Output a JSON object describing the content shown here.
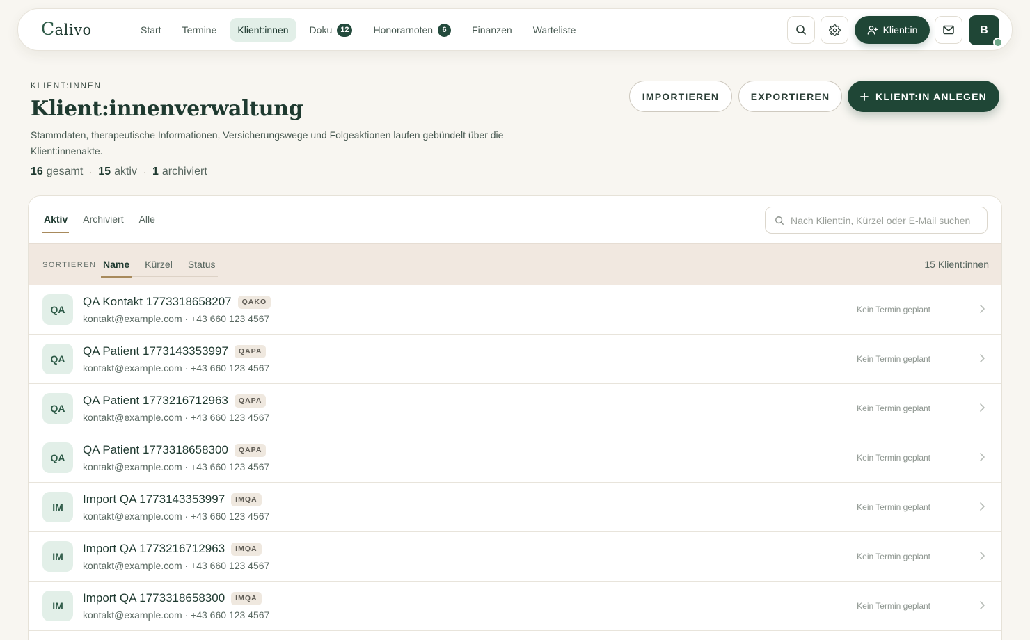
{
  "nav": {
    "logo_first": "C",
    "logo_rest": "alivo",
    "items": [
      {
        "label": "Start",
        "badge": null
      },
      {
        "label": "Termine",
        "badge": null
      },
      {
        "label": "Klient:innen",
        "badge": null,
        "active": true
      },
      {
        "label": "Doku",
        "badge": "12"
      },
      {
        "label": "Honorarnoten",
        "badge": "6"
      },
      {
        "label": "Finanzen",
        "badge": null
      },
      {
        "label": "Warteliste",
        "badge": null
      }
    ],
    "new_client_label": "Klient:in",
    "avatar_initial": "B",
    "icons": [
      "search-icon",
      "gear-icon",
      "user-plus-icon",
      "mail-icon"
    ]
  },
  "header": {
    "eyebrow": "KLIENT:INNEN",
    "title": "Klient:innenverwaltung",
    "description": "Stammdaten, therapeutische Informationen, Versicherungswege und Folgeaktionen laufen gebündelt über die Klient:innenakte.",
    "stats": {
      "total_value": "16",
      "total_label": "gesamt",
      "active_value": "15",
      "active_label": "aktiv",
      "archived_value": "1",
      "archived_label": "archiviert"
    },
    "import_label": "IMPORTIEREN",
    "export_label": "EXPORTIEREN",
    "create_label": "KLIENT:IN ANLEGEN"
  },
  "filter_tabs": [
    {
      "label": "Aktiv",
      "active": true
    },
    {
      "label": "Archiviert",
      "active": false
    },
    {
      "label": "Alle",
      "active": false
    }
  ],
  "search": {
    "placeholder": "Nach Klient:in, Kürzel oder E-Mail suchen",
    "value": ""
  },
  "sort": {
    "label": "SORTIEREN",
    "options": [
      {
        "label": "Name",
        "active": true
      },
      {
        "label": "Kürzel",
        "active": false
      },
      {
        "label": "Status",
        "active": false
      }
    ],
    "count_label": "15 Klient:innen"
  },
  "clients": [
    {
      "initials": "QA",
      "name": "QA Kontakt 1773318658207",
      "tag": "QAKO",
      "contact": "kontakt@example.com · +43 660 123 4567",
      "status": "Kein Termin geplant"
    },
    {
      "initials": "QA",
      "name": "QA Patient 1773143353997",
      "tag": "QAPA",
      "contact": "kontakt@example.com · +43 660 123 4567",
      "status": "Kein Termin geplant"
    },
    {
      "initials": "QA",
      "name": "QA Patient 1773216712963",
      "tag": "QAPA",
      "contact": "kontakt@example.com · +43 660 123 4567",
      "status": "Kein Termin geplant"
    },
    {
      "initials": "QA",
      "name": "QA Patient 1773318658300",
      "tag": "QAPA",
      "contact": "kontakt@example.com · +43 660 123 4567",
      "status": "Kein Termin geplant"
    },
    {
      "initials": "IM",
      "name": "Import QA 1773143353997",
      "tag": "IMQA",
      "contact": "kontakt@example.com · +43 660 123 4567",
      "status": "Kein Termin geplant"
    },
    {
      "initials": "IM",
      "name": "Import QA 1773216712963",
      "tag": "IMQA",
      "contact": "kontakt@example.com · +43 660 123 4567",
      "status": "Kein Termin geplant"
    },
    {
      "initials": "IM",
      "name": "Import QA 1773318658300",
      "tag": "IMQA",
      "contact": "kontakt@example.com · +43 660 123 4567",
      "status": "Kein Termin geplant"
    }
  ],
  "colors": {
    "brand": "#1f4636",
    "accent": "#a88a5c",
    "soft_green": "#e2efe8",
    "sort_bar": "#f1e8e0"
  }
}
